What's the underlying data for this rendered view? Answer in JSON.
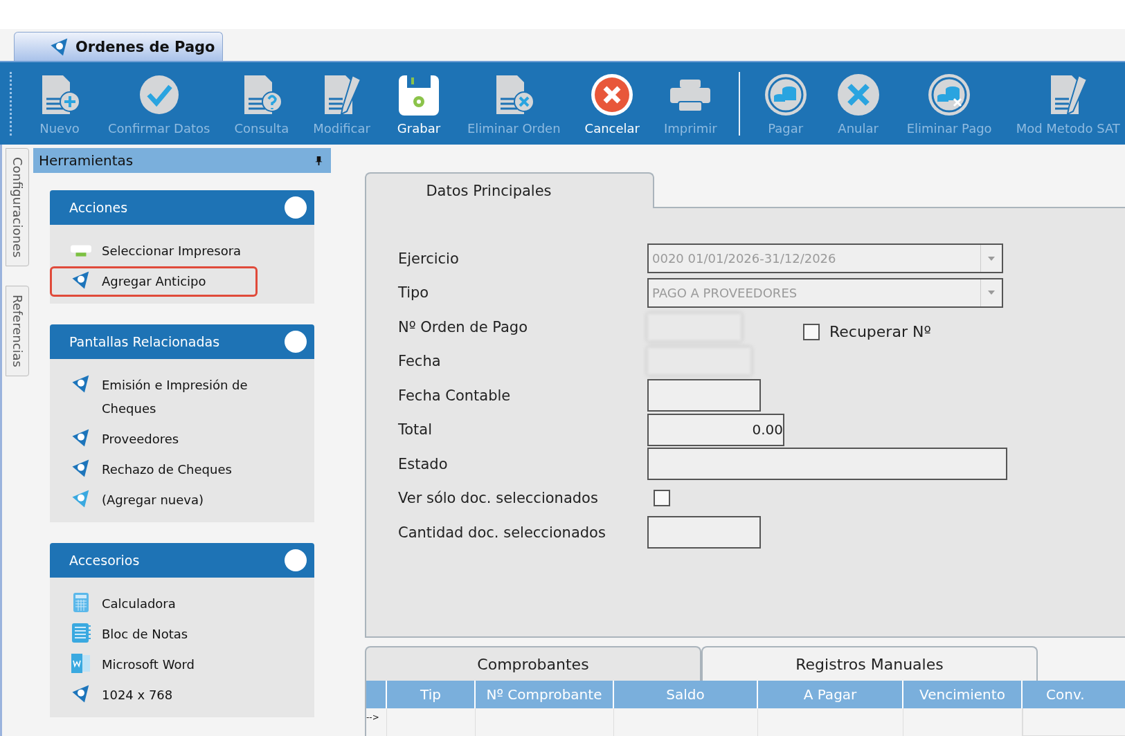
{
  "document_tab": {
    "title": "Ordenes de Pago"
  },
  "toolbar": [
    {
      "label": "Nuevo",
      "kind": "doc-plus",
      "disabled": true
    },
    {
      "label": "Confirmar Datos",
      "kind": "check",
      "disabled": true
    },
    {
      "label": "Consulta",
      "kind": "doc-question",
      "disabled": true
    },
    {
      "label": "Modificar",
      "kind": "doc-pencil",
      "disabled": true
    },
    {
      "label": "Grabar",
      "kind": "save",
      "disabled": false
    },
    {
      "label": "Eliminar Orden",
      "kind": "doc-x",
      "disabled": true
    },
    {
      "label": "Cancelar",
      "kind": "cancel",
      "disabled": false
    },
    {
      "label": "Imprimir",
      "kind": "print",
      "disabled": true
    },
    {
      "label": "Pagar",
      "kind": "coins",
      "disabled": true,
      "separator_before": true
    },
    {
      "label": "Anular",
      "kind": "x",
      "disabled": true
    },
    {
      "label": "Eliminar Pago",
      "kind": "coins-x",
      "disabled": true
    },
    {
      "label": "Mod Metodo SAT",
      "kind": "doc-pencil",
      "disabled": true
    }
  ],
  "side_tabs": [
    "Configuraciones",
    "Referencias"
  ],
  "tools_panel": {
    "title": "Herramientas",
    "groups": [
      {
        "title": "Acciones",
        "items": [
          {
            "label": "Seleccionar Impresora",
            "kind": "printer",
            "highlighted": false
          },
          {
            "label": "Agregar Anticipo",
            "kind": "app",
            "highlighted": true
          }
        ]
      },
      {
        "title": "Pantallas Relacionadas",
        "items": [
          {
            "label": "Emisión e Impresión de Cheques",
            "kind": "app",
            "highlighted": false
          },
          {
            "label": "Proveedores",
            "kind": "app",
            "highlighted": false
          },
          {
            "label": "Rechazo de Cheques",
            "kind": "app",
            "highlighted": false
          },
          {
            "label": "(Agregar nueva)",
            "kind": "app-new",
            "highlighted": false
          }
        ]
      },
      {
        "title": "Accesorios",
        "items": [
          {
            "label": "Calculadora",
            "kind": "calculator",
            "highlighted": false
          },
          {
            "label": "Bloc de Notas",
            "kind": "notepad",
            "highlighted": false
          },
          {
            "label": "Microsoft Word",
            "kind": "word",
            "highlighted": false
          },
          {
            "label": "1024 x 768",
            "kind": "app",
            "highlighted": false
          }
        ]
      }
    ]
  },
  "main_tab": {
    "title": "Datos Principales"
  },
  "form": [
    {
      "label": "Ejercicio",
      "kind": "combo",
      "value": "0020 01/01/2026-31/12/2026"
    },
    {
      "label": "Tipo",
      "kind": "combo",
      "value": "PAGO A PROVEEDORES"
    },
    {
      "label": "Nº Orden de Pago",
      "kind": "blurred",
      "extra_checkbox": {
        "label": "Recuperar Nº",
        "checked": false
      }
    },
    {
      "label": "Fecha",
      "kind": "blurred-combo"
    },
    {
      "label": "Fecha Contable",
      "kind": "text"
    },
    {
      "label": "Total",
      "kind": "number",
      "value": "0.00"
    },
    {
      "label": "Estado",
      "kind": "memo"
    },
    {
      "label": "Ver sólo doc. seleccionados",
      "kind": "checkbox",
      "checked": false
    },
    {
      "label": "Cantidad doc. seleccionados",
      "kind": "text"
    }
  ],
  "bottom_tabs": [
    {
      "label": "Comprobantes",
      "selected": true
    },
    {
      "label": "Registros Manuales",
      "selected": false
    }
  ],
  "grid": {
    "columns": [
      "Tip",
      "Nº Comprobante",
      "Saldo",
      "A Pagar",
      "Vencimiento",
      "Conv."
    ],
    "row_marker": "-->"
  }
}
